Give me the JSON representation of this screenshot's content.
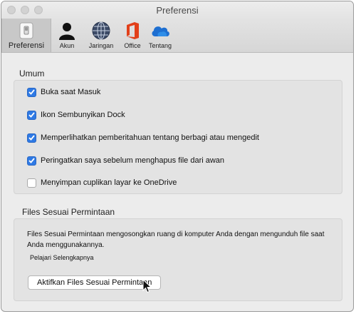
{
  "window": {
    "title": "Preferensi"
  },
  "toolbar": {
    "items": [
      {
        "label": "Preferensi",
        "icon": "switch-icon",
        "selected": true
      },
      {
        "label": "Akun",
        "icon": "person-icon"
      },
      {
        "label": "Jaringan",
        "icon": "globe-icon"
      },
      {
        "label": "Office",
        "icon": "office-logo-icon"
      },
      {
        "label": "Tentang",
        "icon": "cloud-icon"
      }
    ]
  },
  "general": {
    "title": "Umum",
    "options": [
      {
        "label": "Buka saat Masuk",
        "checked": true
      },
      {
        "label": "Ikon Sembunyikan Dock",
        "checked": true
      },
      {
        "label": "Memperlihatkan pemberitahuan tentang berbagi atau mengedit",
        "checked": true
      },
      {
        "label": "Peringatkan saya sebelum menghapus file dari awan",
        "checked": true
      },
      {
        "label": "Menyimpan cuplikan layar ke OneDrive",
        "checked": false
      }
    ]
  },
  "files_on_demand": {
    "title": "Files Sesuai Permintaan",
    "description": "Files Sesuai Permintaan mengosongkan ruang di komputer Anda dengan mengunduh file saat Anda menggunakannya.",
    "learn_more": "Pelajari Selengkapnya",
    "button_label": "Aktifkan Files Sesuai Permintaan"
  },
  "colors": {
    "checkbox_accent": "#2f7ae5",
    "office_red": "#e2401a",
    "onedrive_blue": "#1e6fd1"
  }
}
